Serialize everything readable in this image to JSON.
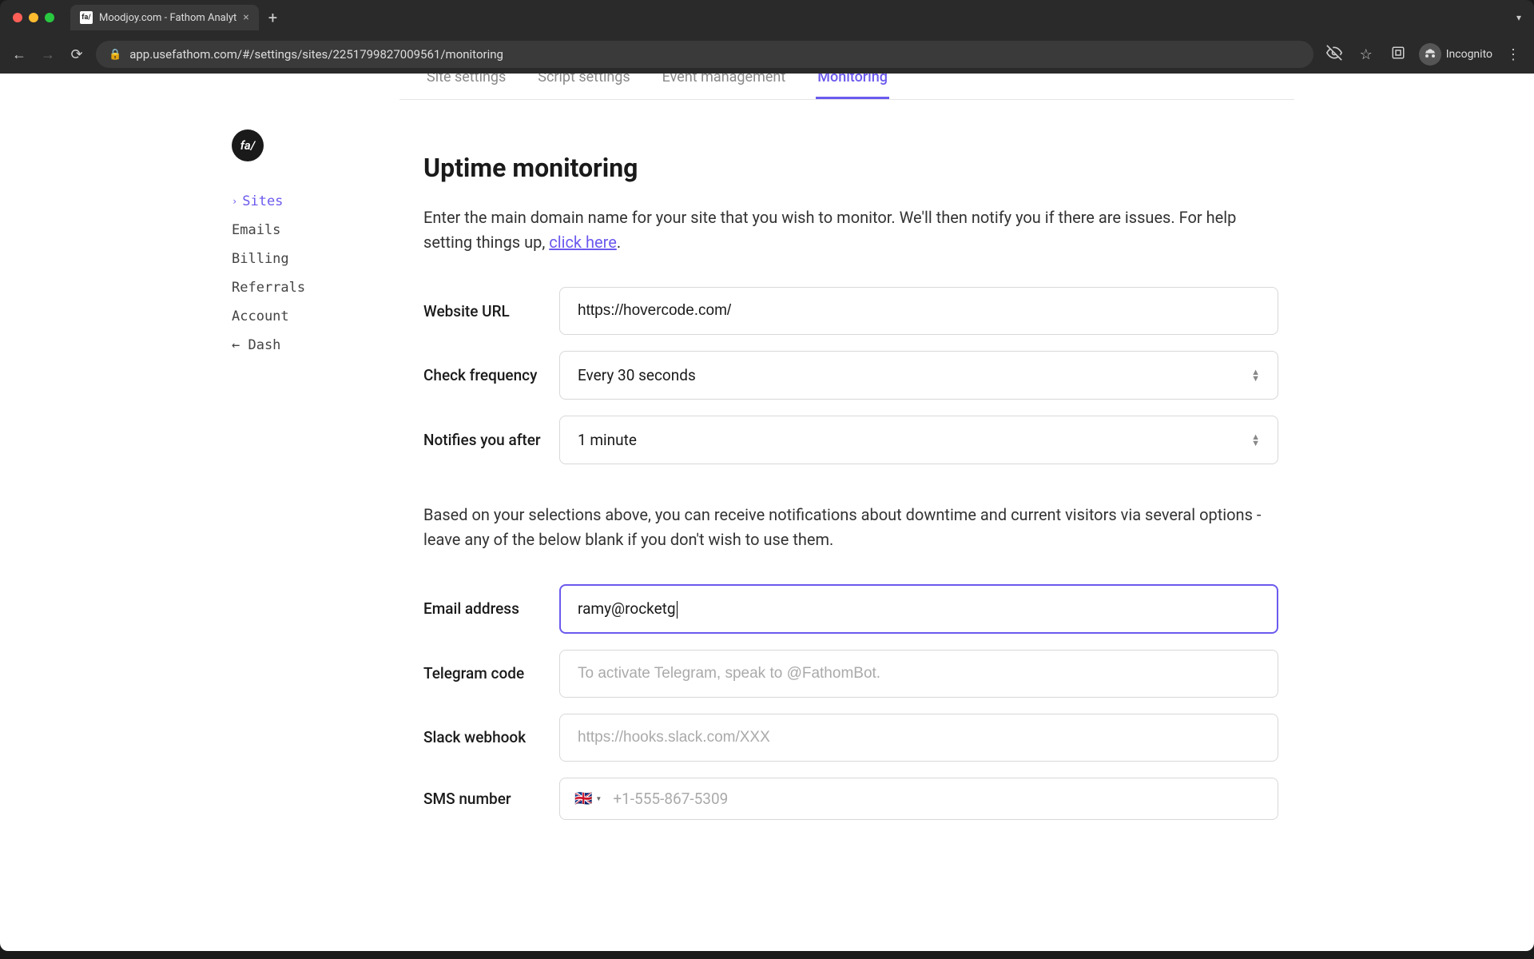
{
  "browser": {
    "tab_title": "Moodjoy.com - Fathom Analyt",
    "url": "app.usefathom.com/#/settings/sites/2251799827009561/monitoring",
    "incognito_label": "Incognito"
  },
  "tabs": {
    "items": [
      {
        "label": "Site settings",
        "active": false
      },
      {
        "label": "Script settings",
        "active": false
      },
      {
        "label": "Event management",
        "active": false
      },
      {
        "label": "Monitoring",
        "active": true
      }
    ]
  },
  "sidebar": {
    "logo_text": "fa/",
    "items": [
      {
        "label": "Sites",
        "active": true,
        "chevron": true
      },
      {
        "label": "Emails",
        "active": false
      },
      {
        "label": "Billing",
        "active": false
      },
      {
        "label": "Referrals",
        "active": false
      },
      {
        "label": "Account",
        "active": false
      }
    ],
    "back_label": "← Dash"
  },
  "page": {
    "title": "Uptime monitoring",
    "description_pre": "Enter the main domain name for your site that you wish to monitor. We'll then notify you if there are issues. For help setting things up, ",
    "description_link": "click here",
    "description_post": ".",
    "sub_description": "Based on your selections above, you can receive notifications about downtime and current visitors via several options - leave any of the below blank if you don't wish to use them."
  },
  "form": {
    "website_url": {
      "label": "Website URL",
      "value": "https://hovercode.com/"
    },
    "check_frequency": {
      "label": "Check frequency",
      "value": "Every 30 seconds"
    },
    "notifies_after": {
      "label": "Notifies you after",
      "value": "1 minute"
    },
    "email": {
      "label": "Email address",
      "value": "ramy@rocketg"
    },
    "telegram": {
      "label": "Telegram code",
      "placeholder": "To activate Telegram, speak to @FathomBot."
    },
    "slack": {
      "label": "Slack webhook",
      "placeholder": "https://hooks.slack.com/XXX"
    },
    "sms": {
      "label": "SMS number",
      "placeholder": "+1-555-867-5309",
      "flag": "🇬🇧"
    }
  }
}
